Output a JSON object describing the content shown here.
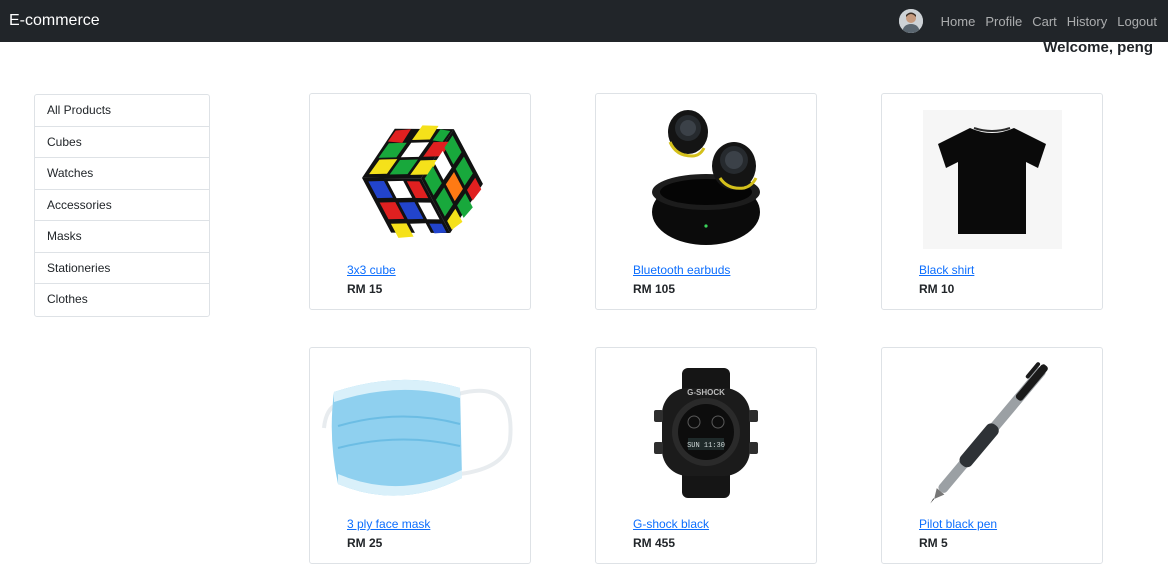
{
  "navbar": {
    "brand": "E-commerce",
    "links": [
      "Home",
      "Profile",
      "Cart",
      "History",
      "Logout"
    ]
  },
  "welcome": "Welcome, peng",
  "categories": [
    "All Products",
    "Cubes",
    "Watches",
    "Accessories",
    "Masks",
    "Stationeries",
    "Clothes"
  ],
  "products": [
    {
      "name": "3x3 cube",
      "price": "RM 15"
    },
    {
      "name": "Bluetooth earbuds",
      "price": "RM 105"
    },
    {
      "name": "Black shirt",
      "price": "RM 10"
    },
    {
      "name": "3 ply face mask",
      "price": "RM 25"
    },
    {
      "name": "G-shock black",
      "price": "RM 455"
    },
    {
      "name": "Pilot black pen",
      "price": "RM 5"
    }
  ],
  "image_text": {
    "watch_brand": "G-SHOCK",
    "watch_display": "SUN 11:30"
  },
  "colors": {
    "navbar_bg": "#212529",
    "link": "#0d6efd",
    "border": "#dee2e6"
  }
}
